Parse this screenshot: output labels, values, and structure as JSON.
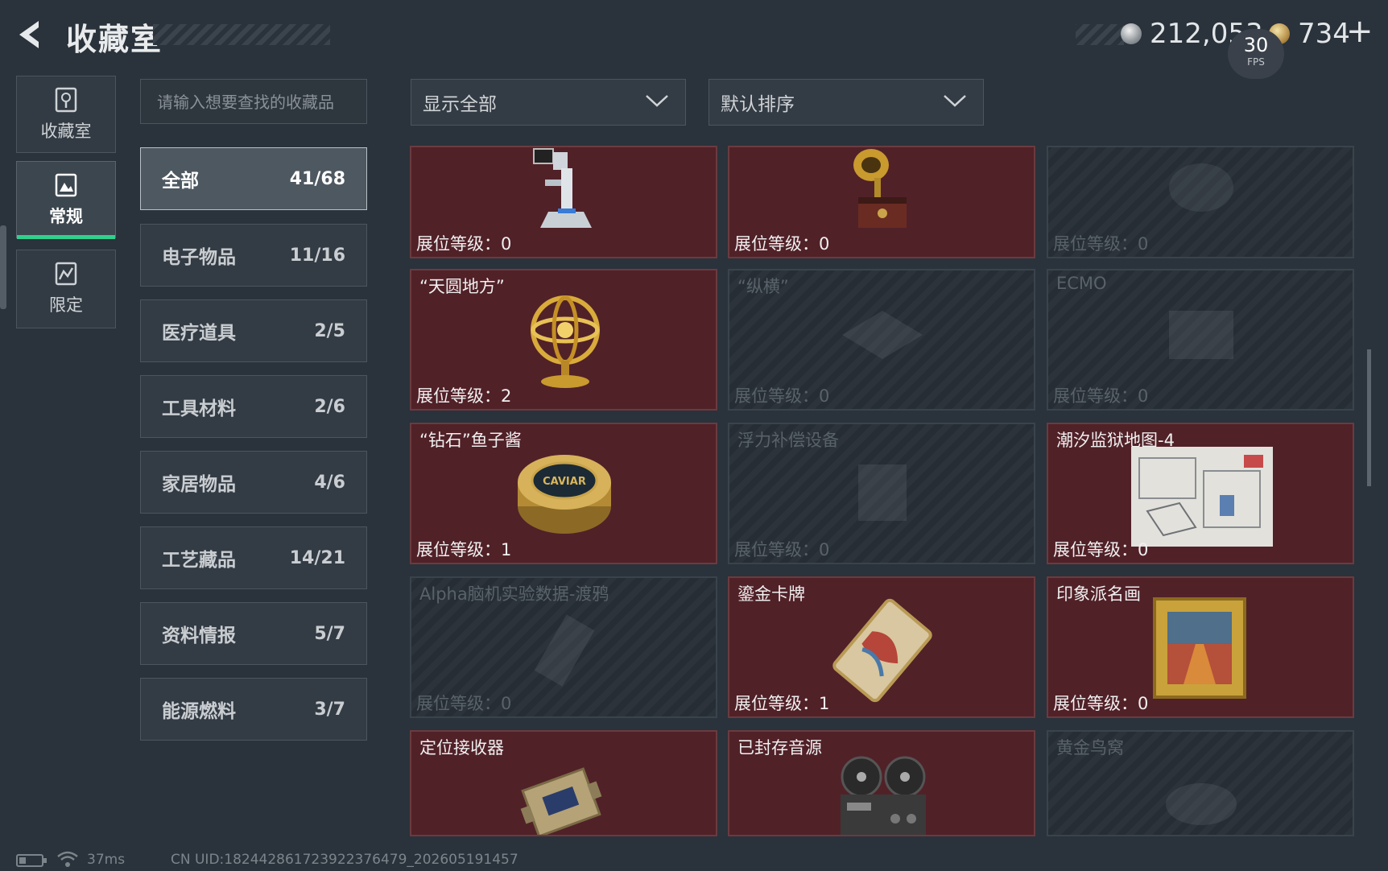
{
  "header": {
    "title": "收藏室",
    "currency_silver": "212,053",
    "currency_gold": "734",
    "plus_symbol": "+",
    "fps_value": "30",
    "fps_label": "FPS"
  },
  "side_nav": [
    {
      "label": "收藏室",
      "icon": "vault-icon",
      "active": false
    },
    {
      "label": "常规",
      "icon": "image-icon",
      "active": true
    },
    {
      "label": "限定",
      "icon": "limited-icon",
      "active": false
    }
  ],
  "search": {
    "placeholder": "请输入想要查找的收藏品"
  },
  "categories": [
    {
      "label": "全部",
      "count": "41/68"
    },
    {
      "label": "电子物品",
      "count": "11/16"
    },
    {
      "label": "医疗道具",
      "count": "2/5"
    },
    {
      "label": "工具材料",
      "count": "2/6"
    },
    {
      "label": "家居物品",
      "count": "4/6"
    },
    {
      "label": "工艺藏品",
      "count": "14/21"
    },
    {
      "label": "资料情报",
      "count": "5/7"
    },
    {
      "label": "能源燃料",
      "count": "3/7"
    }
  ],
  "filters": {
    "display": "显示全部",
    "sort": "默认排序"
  },
  "items": [
    {
      "name": "",
      "level_text": "展位等级：0",
      "owned": true,
      "icon": "surgical-robot-icon"
    },
    {
      "name": "",
      "level_text": "展位等级：0",
      "owned": true,
      "icon": "gramophone-icon"
    },
    {
      "name": "",
      "level_text": "展位等级：0",
      "owned": false,
      "icon": "helmet-icon"
    },
    {
      "name": "“天圆地方”",
      "level_text": "展位等级：2",
      "owned": true,
      "icon": "armillary-sphere-icon"
    },
    {
      "name": "“纵横”",
      "level_text": "展位等级：0",
      "owned": false,
      "icon": "board-icon"
    },
    {
      "name": "ECMO",
      "level_text": "展位等级：0",
      "owned": false,
      "icon": "ecmo-icon"
    },
    {
      "name": "“钻石”鱼子酱",
      "level_text": "展位等级：1",
      "owned": true,
      "icon": "caviar-tin-icon",
      "art_text": "CAVIAR"
    },
    {
      "name": "浮力补偿设备",
      "level_text": "展位等级：0",
      "owned": false,
      "icon": "bcd-vest-icon"
    },
    {
      "name": "潮汐监狱地图-4",
      "level_text": "展位等级：0",
      "owned": true,
      "icon": "map-icon"
    },
    {
      "name": "Alpha脑机实验数据-渡鸦",
      "level_text": "展位等级：0",
      "owned": false,
      "icon": "data-drive-icon"
    },
    {
      "name": "鎏金卡牌",
      "level_text": "展位等级：1",
      "owned": true,
      "icon": "gilded-card-icon"
    },
    {
      "name": "印象派名画",
      "level_text": "展位等级：0",
      "owned": true,
      "icon": "painting-icon"
    },
    {
      "name": "定位接收器",
      "level_text": "",
      "owned": true,
      "icon": "receiver-icon"
    },
    {
      "name": "已封存音源",
      "level_text": "",
      "owned": true,
      "icon": "tape-recorder-icon"
    },
    {
      "name": "黄金鸟窝",
      "level_text": "",
      "owned": false,
      "icon": "golden-nest-icon"
    }
  ],
  "footer": {
    "ping": "37ms",
    "uid": "CN UID:18244286172392237647​9_202605191457"
  },
  "colors": {
    "accent_green": "#2fd08c",
    "owned_card": "#512128",
    "background": "#2a323b"
  }
}
